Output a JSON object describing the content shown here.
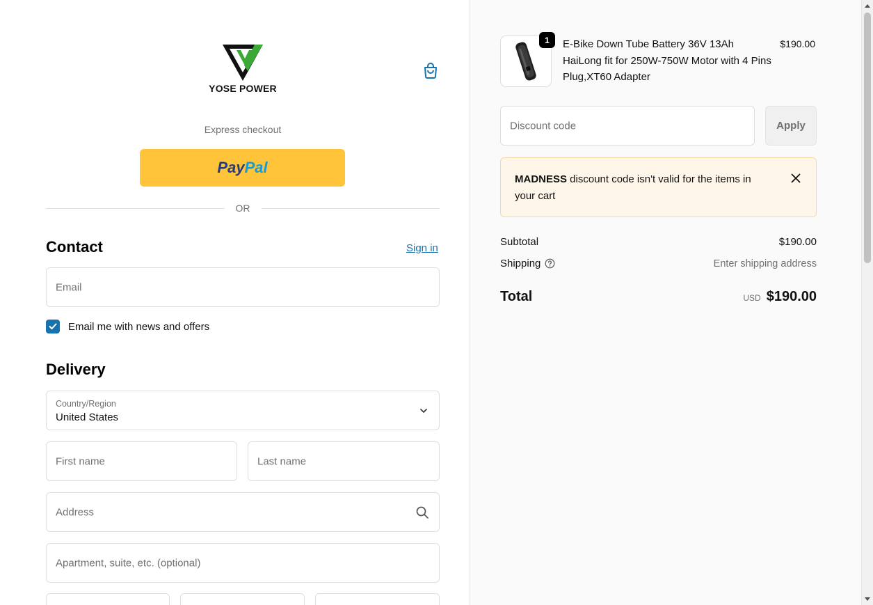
{
  "brand": {
    "name": "YOSE POWER"
  },
  "express": {
    "label": "Express checkout",
    "paypal_dark": "Pay",
    "paypal_light": "Pal"
  },
  "divider": {
    "or": "OR"
  },
  "contact": {
    "heading": "Contact",
    "sign_in": "Sign in",
    "email_placeholder": "Email",
    "newsletter_label": "Email me with news and offers",
    "newsletter_checked": true
  },
  "delivery": {
    "heading": "Delivery",
    "country_label": "Country/Region",
    "country_value": "United States",
    "first_name_placeholder": "First name",
    "last_name_placeholder": "Last name",
    "address_placeholder": "Address",
    "apartment_placeholder": "Apartment, suite, etc. (optional)"
  },
  "order": {
    "item": {
      "name": "E-Bike Down Tube Battery 36V 13Ah HaiLong fit for 250W-750W Motor with 4 Pins Plug,XT60 Adapter",
      "price": "$190.00",
      "quantity": "1"
    },
    "discount": {
      "placeholder": "Discount code",
      "apply_label": "Apply",
      "error_code": "MADNESS",
      "error_message": " discount code isn't valid for the items in your cart"
    },
    "subtotal_label": "Subtotal",
    "subtotal_value": "$190.00",
    "shipping_label": "Shipping",
    "shipping_value": "Enter shipping address",
    "total_label": "Total",
    "currency": "USD",
    "total_value": "$190.00"
  },
  "colors": {
    "accent": "#1773b0",
    "paypal_yellow": "#ffc439",
    "alert_bg": "#fff6ea",
    "logo_green": "#3aa935"
  },
  "icons": [
    "shopping-bag-icon",
    "chevron-down-icon",
    "search-icon",
    "close-icon",
    "help-circle-icon",
    "checkmark-icon",
    "battery-product-image"
  ]
}
